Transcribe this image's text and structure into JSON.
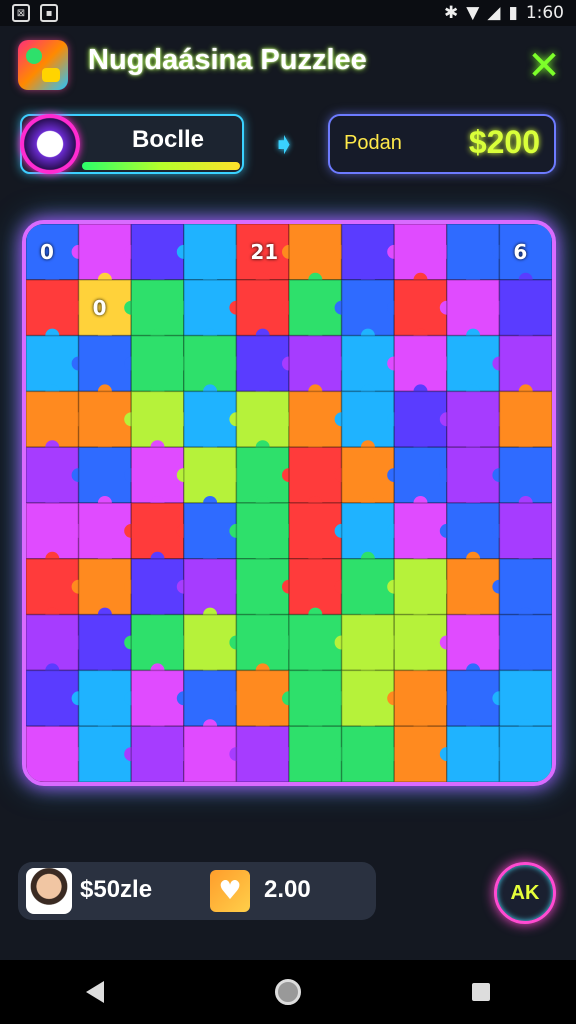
{
  "status_bar": {
    "time": "1:60"
  },
  "header": {
    "title": "Nugdaásina Puzzlee",
    "close_glyph": "✕"
  },
  "player": {
    "name": "Boclle"
  },
  "score": {
    "label": "Podan",
    "value": "$200"
  },
  "board": {
    "cols": 10,
    "rows": 10,
    "palette": [
      "#2f6bff",
      "#a63cff",
      "#ff3b3b",
      "#ff8a1f",
      "#2ee06b",
      "#1fb3ff",
      "#b6f23a",
      "#e04bff",
      "#5a3cff",
      "#ffd23a"
    ],
    "cells": [
      [
        0,
        7,
        8,
        5,
        2,
        3,
        8,
        7,
        0,
        0
      ],
      [
        2,
        9,
        4,
        5,
        2,
        4,
        0,
        2,
        7,
        8
      ],
      [
        5,
        0,
        4,
        4,
        8,
        1,
        5,
        7,
        5,
        1
      ],
      [
        3,
        3,
        6,
        5,
        6,
        3,
        5,
        8,
        1,
        3
      ],
      [
        1,
        0,
        7,
        6,
        4,
        2,
        3,
        0,
        1,
        0
      ],
      [
        7,
        7,
        2,
        0,
        4,
        2,
        5,
        7,
        0,
        1
      ],
      [
        2,
        3,
        8,
        1,
        4,
        2,
        4,
        6,
        3,
        0
      ],
      [
        1,
        8,
        4,
        6,
        4,
        4,
        6,
        6,
        7,
        0
      ],
      [
        8,
        5,
        7,
        0,
        3,
        4,
        6,
        3,
        0,
        5
      ],
      [
        7,
        5,
        1,
        7,
        1,
        4,
        4,
        3,
        5,
        5
      ]
    ],
    "badges": [
      {
        "text": "0",
        "col": 0,
        "row": 0
      },
      {
        "text": "21",
        "col": 4,
        "row": 0
      },
      {
        "text": "6",
        "col": 9,
        "row": 0
      },
      {
        "text": "0",
        "col": 1,
        "row": 1
      }
    ]
  },
  "footer": {
    "coins": "$50zle",
    "heart_glyph": "♥",
    "lives": "2.00",
    "action_label": "AK"
  }
}
